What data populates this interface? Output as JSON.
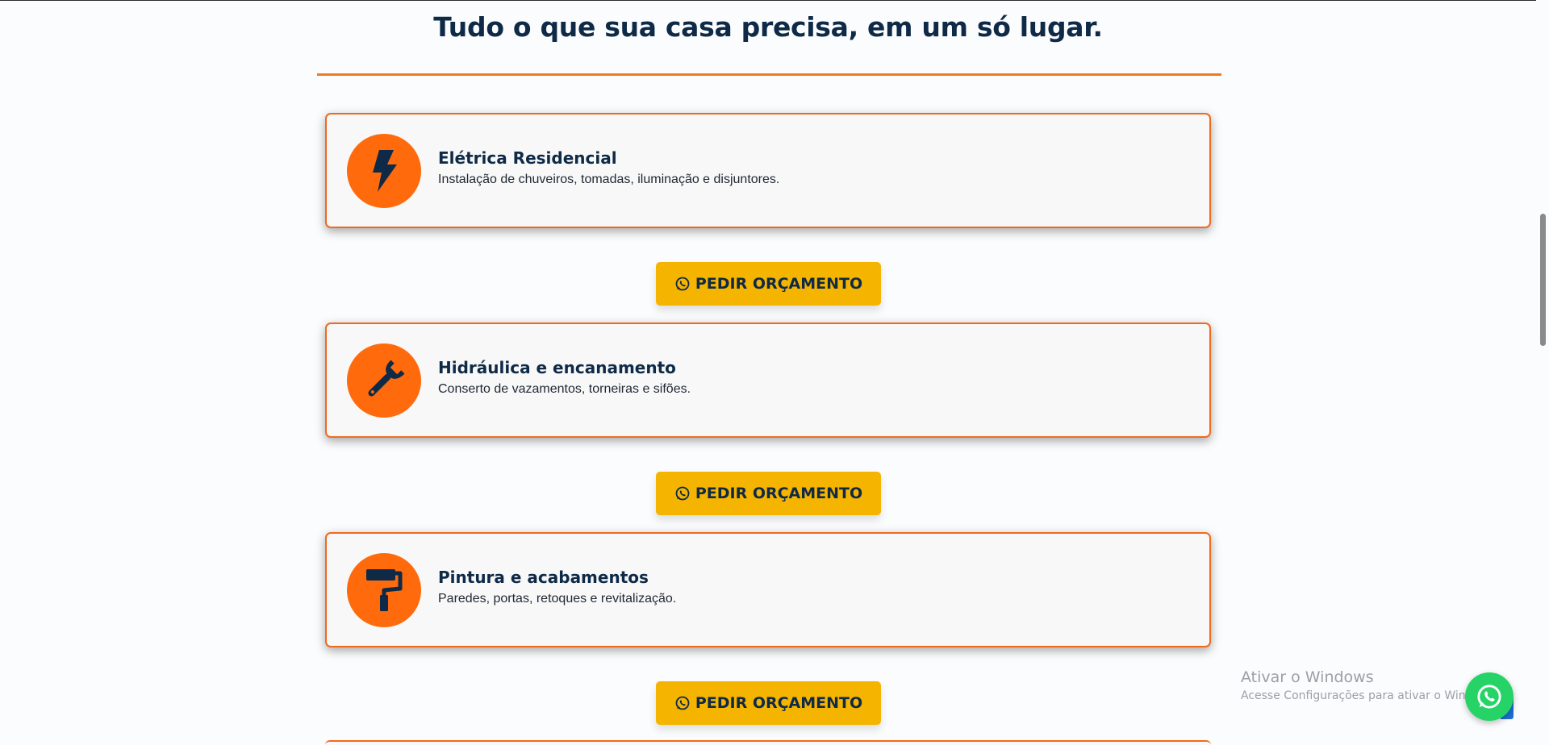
{
  "section": {
    "title": "Tudo o que sua casa precisa, em um só lugar."
  },
  "services": [
    {
      "icon": "lightning-bolt-icon",
      "title": "Elétrica Residencial",
      "description": "Instalação de chuveiros, tomadas, iluminação e disjuntores.",
      "cta_label": "PEDIR ORÇAMENTO"
    },
    {
      "icon": "wrench-icon",
      "title": "Hidráulica e encanamento",
      "description": "Conserto de vazamentos, torneiras e sifões.",
      "cta_label": "PEDIR ORÇAMENTO"
    },
    {
      "icon": "paint-roller-icon",
      "title": "Pintura e acabamentos",
      "description": "Paredes, portas, retoques e revitalização.",
      "cta_label": "PEDIR ORÇAMENTO"
    }
  ],
  "windows_activation": {
    "title": "Ativar o Windows",
    "subtitle": "Acesse Configurações para ativar o Windows."
  },
  "colors": {
    "accent_orange": "#ff6a0d",
    "card_border": "#f06a1d",
    "cta_yellow": "#f5b400",
    "navy": "#0e2a47",
    "whatsapp_green": "#25d366"
  }
}
